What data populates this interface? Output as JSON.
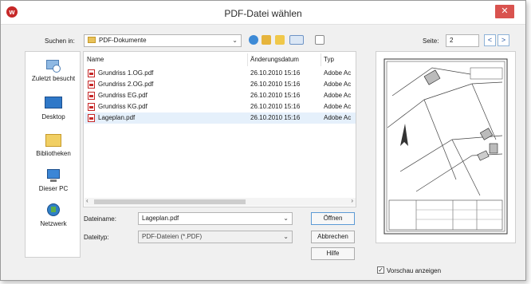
{
  "window": {
    "title": "PDF-Datei wählen",
    "close_glyph": "✕"
  },
  "top": {
    "look_in_label": "Suchen in:",
    "look_in_value": "PDF-Dokumente",
    "page_label": "Seite:",
    "page_value": "2",
    "prev_glyph": "<",
    "next_glyph": ">"
  },
  "places": [
    {
      "label": "Zuletzt besucht",
      "icon": "recent-places-icon"
    },
    {
      "label": "Desktop",
      "icon": "desktop-icon"
    },
    {
      "label": "Bibliotheken",
      "icon": "libraries-icon"
    },
    {
      "label": "Dieser PC",
      "icon": "computer-icon"
    },
    {
      "label": "Netzwerk",
      "icon": "network-icon"
    }
  ],
  "filelist": {
    "columns": [
      "Name",
      "Änderungsdatum",
      "Typ"
    ],
    "rows": [
      {
        "name": "Grundriss 1.OG.pdf",
        "date": "26.10.2010 15:16",
        "type": "Adobe Ac"
      },
      {
        "name": "Grundriss 2.OG.pdf",
        "date": "26.10.2010 15:16",
        "type": "Adobe Ac"
      },
      {
        "name": "Grundriss EG.pdf",
        "date": "26.10.2010 15:16",
        "type": "Adobe Ac"
      },
      {
        "name": "Grundriss KG.pdf",
        "date": "26.10.2010 15:16",
        "type": "Adobe Ac"
      },
      {
        "name": "Lageplan.pdf",
        "date": "26.10.2010 15:16",
        "type": "Adobe Ac"
      }
    ],
    "selected_index": 4
  },
  "bottom": {
    "filename_label": "Dateiname:",
    "filename_value": "Lageplan.pdf",
    "filetype_label": "Dateityp:",
    "filetype_value": "PDF-Dateien (*.PDF)",
    "open_button": "Öffnen",
    "cancel_button": "Abbrechen",
    "help_button": "Hilfe",
    "preview_checkbox_label": "Vorschau anzeigen",
    "preview_checked": true
  },
  "colors": {
    "accent": "#2456a4",
    "close": "#d9534f",
    "pdf": "#c62828",
    "selection": "#e5f0fb"
  }
}
